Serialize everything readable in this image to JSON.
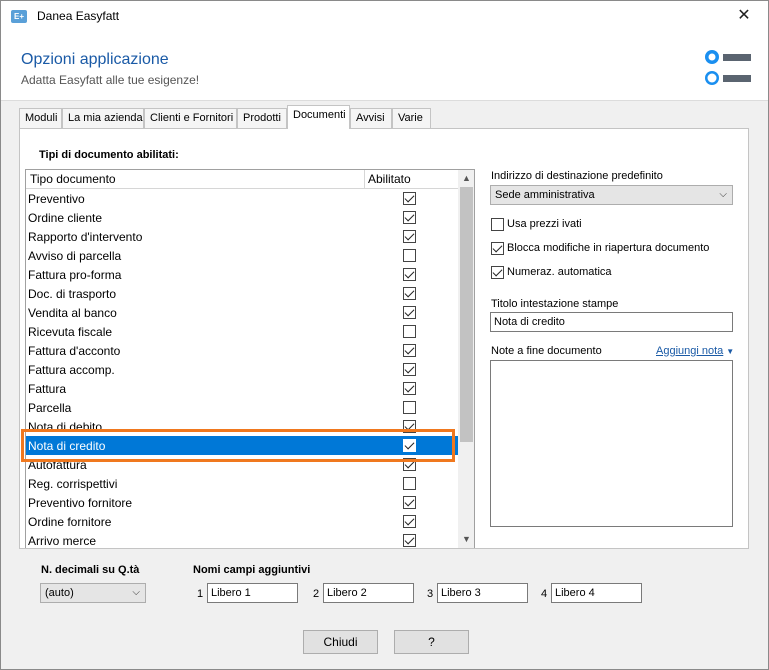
{
  "window": {
    "app_icon": "E+",
    "title": "Danea Easyfatt",
    "close_glyph": "✕"
  },
  "header": {
    "title": "Opzioni applicazione",
    "subtitle": "Adatta Easyfatt alle tue esigenze!",
    "illustration_icon": "toggle-switches-icon"
  },
  "tabs": [
    {
      "label": "Moduli"
    },
    {
      "label": "La mia azienda"
    },
    {
      "label": "Clienti e Fornitori"
    },
    {
      "label": "Prodotti"
    },
    {
      "label": "Documenti",
      "active": true
    },
    {
      "label": "Avvisi"
    },
    {
      "label": "Varie"
    }
  ],
  "documents": {
    "section_label": "Tipi di documento abilitati:",
    "col_type": "Tipo documento",
    "col_enabled": "Abilitato",
    "scroll_up": "▲",
    "scroll_down": "▼",
    "rows": [
      {
        "name": "Preventivo",
        "enabled": true
      },
      {
        "name": "Ordine cliente",
        "enabled": true
      },
      {
        "name": "Rapporto d'intervento",
        "enabled": true
      },
      {
        "name": "Avviso di parcella",
        "enabled": false
      },
      {
        "name": "Fattura pro-forma",
        "enabled": true
      },
      {
        "name": "Doc. di trasporto",
        "enabled": true
      },
      {
        "name": "Vendita al banco",
        "enabled": true
      },
      {
        "name": "Ricevuta fiscale",
        "enabled": false
      },
      {
        "name": "Fattura d'acconto",
        "enabled": true
      },
      {
        "name": "Fattura accomp.",
        "enabled": true
      },
      {
        "name": "Fattura",
        "enabled": true
      },
      {
        "name": "Parcella",
        "enabled": false
      },
      {
        "name": "Nota di debito",
        "enabled": true
      },
      {
        "name": "Nota di credito",
        "enabled": true,
        "selected": true
      },
      {
        "name": "Autofattura",
        "enabled": true
      },
      {
        "name": "Reg. corrispettivi",
        "enabled": false
      },
      {
        "name": "Preventivo fornitore",
        "enabled": true
      },
      {
        "name": "Ordine fornitore",
        "enabled": true
      },
      {
        "name": "Arrivo merce",
        "enabled": true
      }
    ],
    "highlight_color": "#f0781e",
    "selection_color": "#0078d7"
  },
  "right_panel": {
    "dest_label": "Indirizzo di destinazione predefinito",
    "dest_value": "Sede amministrativa",
    "dropdown_glyph": "⌵",
    "options": [
      {
        "label": "Usa prezzi ivati",
        "checked": false
      },
      {
        "label": "Blocca modifiche in riapertura documento",
        "checked": true
      },
      {
        "label": "Numeraz. automatica",
        "checked": true
      }
    ],
    "print_title_label": "Titolo intestazione stampe",
    "print_title_value": "Nota di credito",
    "notes_label": "Note a fine documento",
    "add_note_link": "Aggiungi nota",
    "add_note_caret": "▼"
  },
  "bottom": {
    "decimals_label": "N. decimali su Q.tà",
    "decimals_value": "(auto)",
    "extra_fields_label": "Nomi campi aggiuntivi",
    "extra_fields": [
      {
        "num": "1",
        "value": "Libero 1"
      },
      {
        "num": "2",
        "value": "Libero 2"
      },
      {
        "num": "3",
        "value": "Libero 3"
      },
      {
        "num": "4",
        "value": "Libero 4"
      }
    ]
  },
  "buttons": {
    "close": "Chiudi",
    "help": "?"
  }
}
